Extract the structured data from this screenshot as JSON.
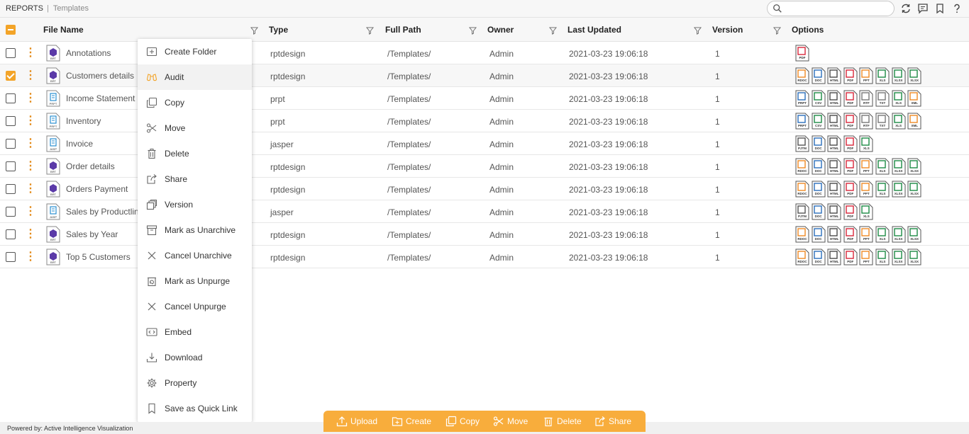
{
  "breadcrumb": {
    "root": "REPORTS",
    "separator": "|",
    "current": "Templates"
  },
  "search": {
    "placeholder": ""
  },
  "columns": {
    "file_name": "File Name",
    "type": "Type",
    "full_path": "Full Path",
    "owner": "Owner",
    "last_updated": "Last Updated",
    "version": "Version",
    "options": "Options"
  },
  "rows": [
    {
      "name": "Annotations",
      "type": "rptdesign",
      "path": "/Templates/",
      "owner": "Admin",
      "updated": "2021-03-23 19:06:18",
      "version": "1",
      "icon": "brt",
      "selected": false,
      "options": [
        "PDF"
      ]
    },
    {
      "name": "Customers details",
      "type": "rptdesign",
      "path": "/Templates/",
      "owner": "Admin",
      "updated": "2021-03-23 19:06:18",
      "version": "1",
      "icon": "brt",
      "selected": true,
      "options": [
        "RDOC",
        "DOC",
        "HTML",
        "PDF",
        "PPT",
        "XLS",
        "XLSX",
        "XLSX"
      ]
    },
    {
      "name": "Income Statement",
      "type": "prpt",
      "path": "/Templates/",
      "owner": "Admin",
      "updated": "2021-03-23 19:06:18",
      "version": "1",
      "icon": "prpt",
      "selected": false,
      "options": [
        "PRPT",
        "CSV",
        "HTML",
        "PDF",
        "RTF",
        "TXT",
        "XLS",
        "XML"
      ]
    },
    {
      "name": "Inventory",
      "type": "prpt",
      "path": "/Templates/",
      "owner": "Admin",
      "updated": "2021-03-23 19:06:18",
      "version": "1",
      "icon": "prpt",
      "selected": false,
      "options": [
        "PRPT",
        "CSV",
        "HTML",
        "PDF",
        "RTF",
        "TXT",
        "XLS",
        "XML"
      ]
    },
    {
      "name": "Invoice",
      "type": "jasper",
      "path": "/Templates/",
      "owner": "Admin",
      "updated": "2021-03-23 19:06:18",
      "version": "1",
      "icon": "jasp",
      "selected": false,
      "options": [
        "PJTM",
        "DOC",
        "HTML",
        "PDF",
        "XLS"
      ]
    },
    {
      "name": "Order details",
      "type": "rptdesign",
      "path": "/Templates/",
      "owner": "Admin",
      "updated": "2021-03-23 19:06:18",
      "version": "1",
      "icon": "brt",
      "selected": false,
      "options": [
        "RDOC",
        "DOC",
        "HTML",
        "PDF",
        "PPT",
        "XLS",
        "XLSX",
        "XLSX"
      ]
    },
    {
      "name": "Orders Payment",
      "type": "rptdesign",
      "path": "/Templates/",
      "owner": "Admin",
      "updated": "2021-03-23 19:06:18",
      "version": "1",
      "icon": "brt",
      "selected": false,
      "options": [
        "RDOC",
        "DOC",
        "HTML",
        "PDF",
        "PPT",
        "XLS",
        "XLSX",
        "XLSX"
      ]
    },
    {
      "name": "Sales by Productline",
      "type": "jasper",
      "path": "/Templates/",
      "owner": "Admin",
      "updated": "2021-03-23 19:06:18",
      "version": "1",
      "icon": "jasp",
      "selected": false,
      "options": [
        "PJTM",
        "DOC",
        "HTML",
        "PDF",
        "XLS"
      ]
    },
    {
      "name": "Sales by Year",
      "type": "rptdesign",
      "path": "/Templates/",
      "owner": "Admin",
      "updated": "2021-03-23 19:06:18",
      "version": "1",
      "icon": "brt",
      "selected": false,
      "options": [
        "RDOC",
        "DOC",
        "HTML",
        "PDF",
        "PPT",
        "XLS",
        "XLSX",
        "XLSX"
      ]
    },
    {
      "name": "Top 5 Customers",
      "type": "rptdesign",
      "path": "/Templates/",
      "owner": "Admin",
      "updated": "2021-03-23 19:06:18",
      "version": "1",
      "icon": "brt",
      "selected": false,
      "options": [
        "RDOC",
        "DOC",
        "HTML",
        "PDF",
        "PPT",
        "XLS",
        "XLSX",
        "XLSX"
      ]
    }
  ],
  "file_icon_labels": {
    "brt": "BRT",
    "prpt": "PRPT",
    "jasp": "JASP"
  },
  "format_colors": {
    "PDF": "#d9263a",
    "RDOC": "#f08a24",
    "DOC": "#2a6ebb",
    "HTML": "#4a4a4a",
    "PPT": "#f08a24",
    "XLS": "#1d8a45",
    "XLSX": "#1d8a45",
    "PRPT": "#2a6ebb",
    "CSV": "#1d8a45",
    "RTF": "#777777",
    "TXT": "#777777",
    "XML": "#f08a24",
    "PJTM": "#555555"
  },
  "context_menu": [
    {
      "label": "Create Folder",
      "icon": "folder-plus-icon",
      "hover": false
    },
    {
      "label": "Audit",
      "icon": "binoculars-icon",
      "hover": true
    },
    {
      "label": "Copy",
      "icon": "copy-icon",
      "hover": false
    },
    {
      "label": "Move",
      "icon": "scissors-icon",
      "hover": false
    },
    {
      "label": "Delete",
      "icon": "trash-icon",
      "hover": false
    },
    {
      "label": "Share",
      "icon": "share-icon",
      "hover": false
    },
    {
      "label": "Version",
      "icon": "version-icon",
      "hover": false
    },
    {
      "label": "Mark as Unarchive",
      "icon": "archive-icon",
      "hover": false
    },
    {
      "label": "Cancel Unarchive",
      "icon": "close-icon",
      "hover": false
    },
    {
      "label": "Mark as Unpurge",
      "icon": "unpurge-icon",
      "hover": false
    },
    {
      "label": "Cancel Unpurge",
      "icon": "close-icon",
      "hover": false
    },
    {
      "label": "Embed",
      "icon": "embed-icon",
      "hover": false
    },
    {
      "label": "Download",
      "icon": "download-icon",
      "hover": false
    },
    {
      "label": "Property",
      "icon": "gear-icon",
      "hover": false
    },
    {
      "label": "Save as Quick Link",
      "icon": "bookmark-icon",
      "hover": false
    }
  ],
  "action_bar": [
    {
      "label": "Upload",
      "icon": "upload-icon"
    },
    {
      "label": "Create",
      "icon": "create-icon"
    },
    {
      "label": "Copy",
      "icon": "copy-icon"
    },
    {
      "label": "Move",
      "icon": "scissors-icon"
    },
    {
      "label": "Delete",
      "icon": "trash-icon"
    },
    {
      "label": "Share",
      "icon": "share-icon"
    }
  ],
  "footer": {
    "powered_by": "Powered by: Active Intelligence Visualization"
  },
  "colors": {
    "accent": "#f3a428",
    "action_bar": "#f8ad3c",
    "kebab": "#e38b1a",
    "file_icon_purple": "#5b3aa8"
  }
}
